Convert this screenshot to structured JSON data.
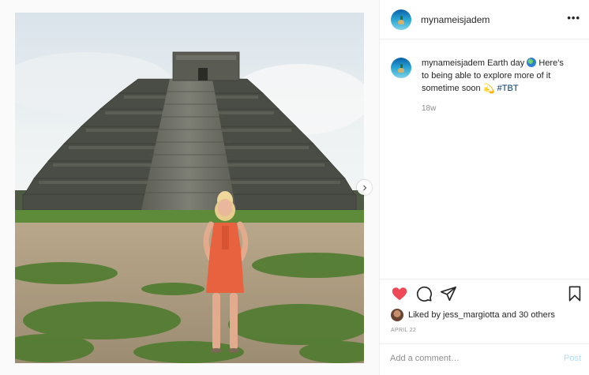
{
  "post": {
    "username": "mynameisjadem",
    "more_label": "•••",
    "caption": {
      "username": "mynameisjadem",
      "text_part1": "Earth day",
      "globe_icon": "globe-emoji",
      "text_part2": "Here's to being able to explore more of it sometime soon",
      "dizzy_icon": "dizzy-emoji",
      "hashtag": "#TBT"
    },
    "age": "18w",
    "likes": {
      "liked_by_prefix": "Liked by",
      "liker": "jess_margiotta",
      "suffix": "and 30 others"
    },
    "date": "APRIL 22",
    "comment": {
      "placeholder": "Add a comment…",
      "post_label": "Post"
    }
  },
  "icons": {
    "like": "heart-filled-icon",
    "comment": "comment-bubble-icon",
    "share": "paper-plane-icon",
    "save": "bookmark-icon",
    "next": "chevron-right-icon"
  },
  "colors": {
    "like_red": "#ed4956",
    "link_blue": "#00376b",
    "post_disabled": "#b2dffc",
    "muted_gray": "#8e8e8e"
  }
}
